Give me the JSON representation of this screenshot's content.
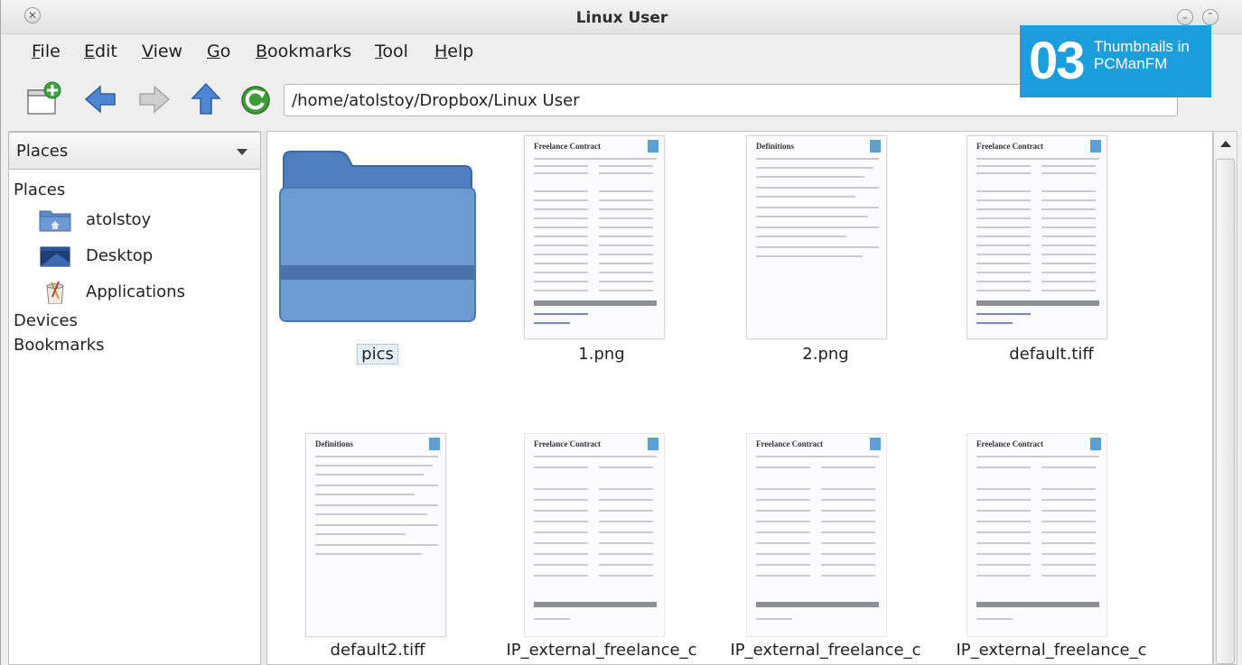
{
  "window": {
    "title": "Linux User"
  },
  "menu": {
    "items": [
      {
        "u": "F",
        "rest": "ile"
      },
      {
        "u": "E",
        "rest": "dit"
      },
      {
        "u": "V",
        "rest": "iew"
      },
      {
        "u": "G",
        "rest": "o"
      },
      {
        "u": "B",
        "rest": "ookmarks"
      },
      {
        "u": "T",
        "rest": "ool"
      },
      {
        "u": "H",
        "rest": "elp"
      }
    ]
  },
  "toolbar": {
    "path": "/home/atolstoy/Dropbox/Linux User"
  },
  "badge": {
    "number": "03",
    "line1": "Thumbnails in",
    "line2": "PCManFM"
  },
  "sidebar": {
    "selector_label": "Places",
    "places_heading": "Places",
    "places": [
      {
        "label": "atolstoy",
        "icon": "home-folder-icon"
      },
      {
        "label": "Desktop",
        "icon": "desktop-icon"
      },
      {
        "label": "Applications",
        "icon": "applications-icon"
      }
    ],
    "devices_heading": "Devices",
    "bookmarks_heading": "Bookmarks"
  },
  "files": [
    {
      "name": "pics",
      "type": "folder"
    },
    {
      "name": "1.png",
      "type": "image"
    },
    {
      "name": "2.png",
      "type": "image"
    },
    {
      "name": "default.tiff",
      "type": "image"
    },
    {
      "name": "default2.tiff",
      "type": "image"
    },
    {
      "name": "IP_external_freelance_c",
      "type": "image"
    },
    {
      "name": "IP_external_freelance_c",
      "type": "image"
    },
    {
      "name": "IP_external_freelance_c",
      "type": "image"
    }
  ],
  "thumbnail_titles": {
    "contract": "Freelance Contract",
    "definitions": "Definitions"
  },
  "colors": {
    "badge": "#1a9fdc",
    "folder": "#5b8bc8",
    "selection": "#e6f0f8"
  }
}
